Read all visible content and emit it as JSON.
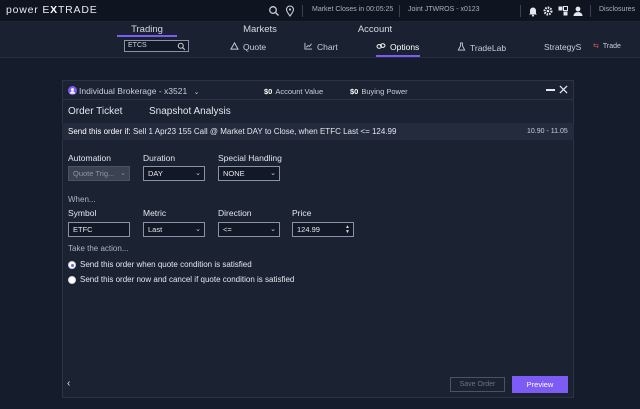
{
  "topbar": {
    "logo_prefix": "power E",
    "logo_x": "X",
    "logo_suffix": "TRADE",
    "market_status": "Market Closes in 00:05:25",
    "account": "Joint JTWROS - x0123",
    "disclosures": "Disclosures"
  },
  "nav": {
    "tabs": [
      "Trading",
      "Markets",
      "Account"
    ],
    "symbol_value": "ETCS",
    "subtabs": [
      "Quote",
      "Chart",
      "Options",
      "TradeLab",
      "StrategyS",
      "Trade"
    ]
  },
  "panel": {
    "account_label": "Individual Brokerage - x3521",
    "account_value_amount": "$0",
    "account_value_label": "Account Value",
    "buying_power_amount": "$0",
    "buying_power_label": "Buying Power",
    "tabs": [
      "Order Ticket",
      "Snapshot Analysis"
    ],
    "send_label": "Send this order if:",
    "send_detail": "Sell 1 Apr23 155 Call @ Market DAY to Close, when ETFC Last <= 124.99",
    "send_range": "10.90 - 11.05"
  },
  "form": {
    "automation_label": "Automation",
    "automation_value": "Quote Trig...",
    "duration_label": "Duration",
    "duration_value": "DAY",
    "special_label": "Special Handling",
    "special_value": "NONE",
    "when_note": "When...",
    "symbol_label": "Symbol",
    "symbol_value": "ETFC",
    "metric_label": "Metric",
    "metric_value": "Last",
    "direction_label": "Direction",
    "direction_value": "<=",
    "price_label": "Price",
    "price_value": "124.99",
    "action_note": "Take the action...",
    "radio1": "Send this order when quote condition is satisfied",
    "radio2": "Send this order now and cancel if quote condition is satisfied"
  },
  "footer": {
    "save_label": "Save Order",
    "preview_label": "Preview"
  },
  "colors": {
    "accent": "#7d5cf5",
    "background": "#151c2b",
    "panel": "#1b2232"
  },
  "icons": [
    "search-icon",
    "location-pin-icon",
    "bell-icon",
    "gear-icon",
    "layout-icon",
    "user-icon",
    "user-circle-icon",
    "minimize-icon",
    "close-icon",
    "triangle-icon",
    "chart-icon",
    "link-icon",
    "flask-icon",
    "back-chevron-icon"
  ]
}
